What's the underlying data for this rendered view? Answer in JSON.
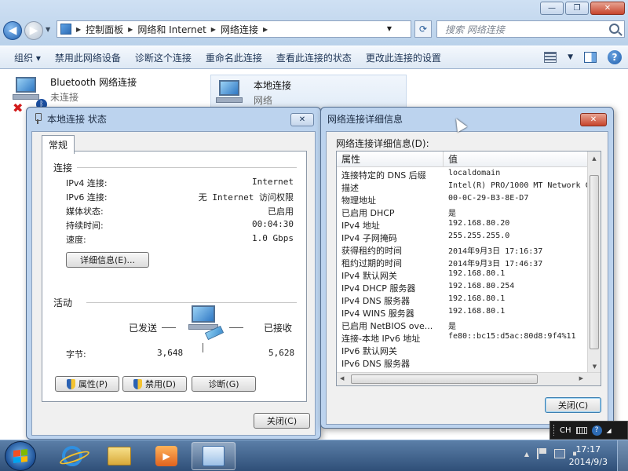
{
  "explorer": {
    "breadcrumbs": [
      "控制面板",
      "网络和 Internet",
      "网络连接"
    ],
    "search_placeholder": "搜索 网络连接",
    "commands": [
      "组织",
      "禁用此网络设备",
      "诊断这个连接",
      "重命名此连接",
      "查看此连接的状态",
      "更改此连接的设置"
    ],
    "window_buttons": {
      "minimize": "—",
      "maximize": "❐",
      "close": "✕"
    }
  },
  "connections": [
    {
      "name": "Bluetooth 网络连接",
      "status": "未连接"
    },
    {
      "name": "本地连接",
      "status": "网络"
    }
  ],
  "status_dialog": {
    "title": "本地连接 状态",
    "tab": "常规",
    "connection_group": "连接",
    "rows": [
      {
        "k": "IPv4 连接:",
        "v": "Internet"
      },
      {
        "k": "IPv6 连接:",
        "v": "无 Internet 访问权限"
      },
      {
        "k": "媒体状态:",
        "v": "已启用"
      },
      {
        "k": "持续时间:",
        "v": "00:04:30"
      },
      {
        "k": "速度:",
        "v": "1.0 Gbps"
      }
    ],
    "details_button": "详细信息(E)...",
    "activity_group": "活动",
    "sent_label": "已发送",
    "received_label": "已接收",
    "bytes_label": "字节:",
    "bytes_sent": "3,648",
    "bytes_received": "5,628",
    "properties_button": "属性(P)",
    "disable_button": "禁用(D)",
    "diagnose_button": "诊断(G)",
    "close_button": "关闭(C)"
  },
  "details_dialog": {
    "title": "网络连接详细信息",
    "label": "网络连接详细信息(D):",
    "col_property": "属性",
    "col_value": "值",
    "rows": [
      {
        "p": "连接特定的 DNS 后缀",
        "v": "localdomain"
      },
      {
        "p": "描述",
        "v": "Intel(R) PRO/1000 MT Network C"
      },
      {
        "p": "物理地址",
        "v": "00-0C-29-B3-8E-D7"
      },
      {
        "p": "已启用 DHCP",
        "v": "是"
      },
      {
        "p": "IPv4 地址",
        "v": "192.168.80.20"
      },
      {
        "p": "IPv4 子网掩码",
        "v": "255.255.255.0"
      },
      {
        "p": "获得租约的时间",
        "v": "2014年9月3日 17:16:37"
      },
      {
        "p": "租约过期的时间",
        "v": "2014年9月3日 17:46:37"
      },
      {
        "p": "IPv4 默认网关",
        "v": "192.168.80.1"
      },
      {
        "p": "IPv4 DHCP 服务器",
        "v": "192.168.80.254"
      },
      {
        "p": "IPv4 DNS 服务器",
        "v": "192.168.80.1"
      },
      {
        "p": "IPv4 WINS 服务器",
        "v": "192.168.80.1"
      },
      {
        "p": "已启用 NetBIOS ove...",
        "v": "是"
      },
      {
        "p": "连接-本地 IPv6 地址",
        "v": "fe80::bc15:d5ac:80d8:9f4%11"
      },
      {
        "p": "IPv6 默认网关",
        "v": ""
      },
      {
        "p": "IPv6 DNS 服务器",
        "v": ""
      }
    ],
    "close_button": "关闭(C)"
  },
  "langbar": {
    "lang": "CH"
  },
  "taskbar": {
    "time": "17:17",
    "date": "2014/9/3"
  }
}
